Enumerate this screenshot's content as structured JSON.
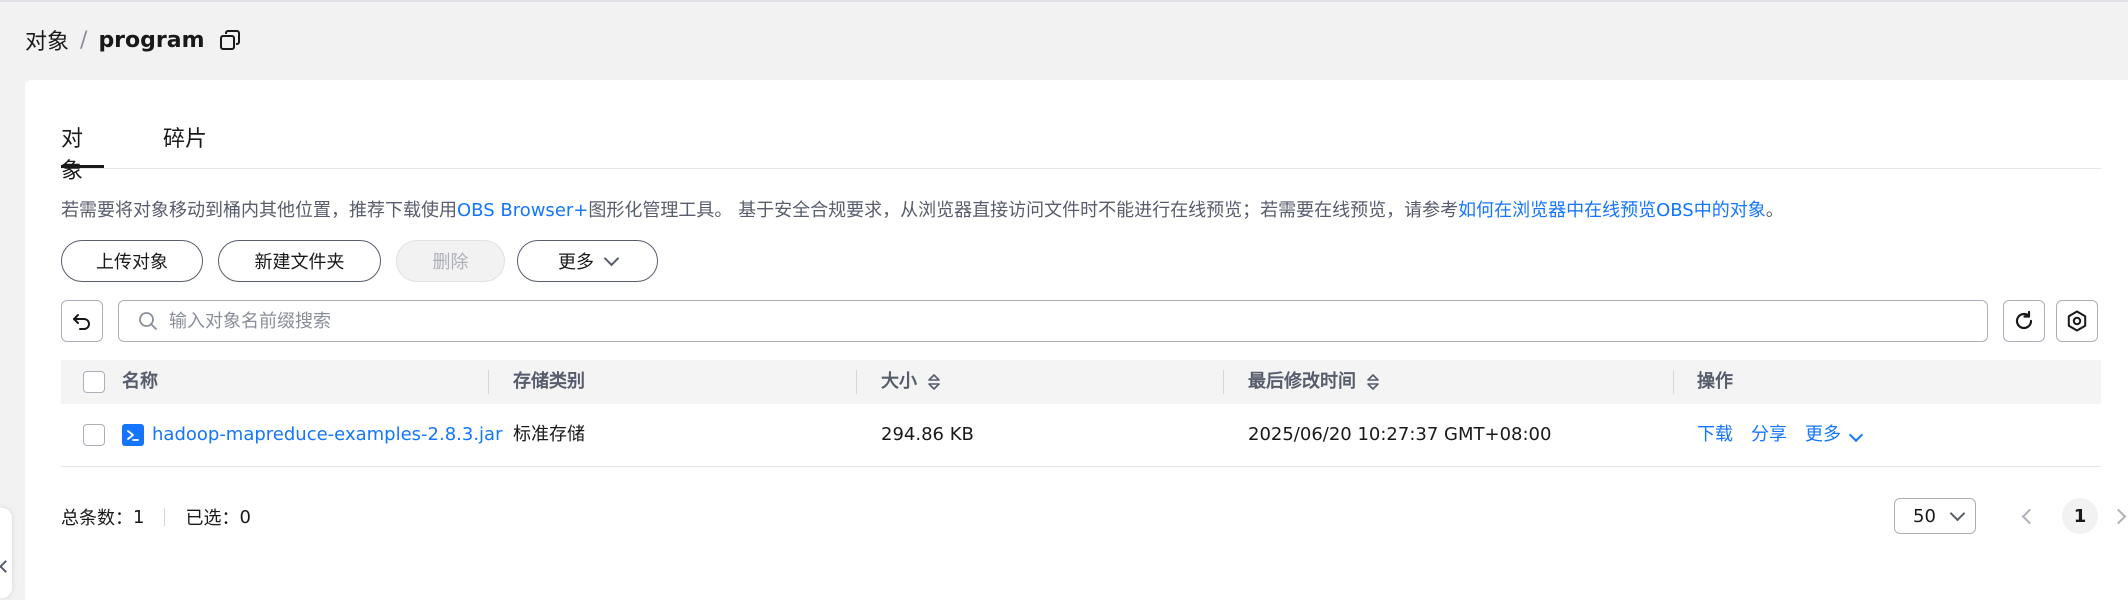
{
  "breadcrumb": {
    "root": "对象",
    "separator": "/",
    "current": "program"
  },
  "tabs": [
    {
      "label": "对象"
    },
    {
      "label": "碎片"
    }
  ],
  "notice": {
    "text1": "若需要将对象移动到桶内其他位置，推荐下载使用",
    "link1": "OBS Browser+",
    "text2": "图形化管理工具。 基于安全合规要求，从浏览器直接访问文件时不能进行在线预览；若需要在线预览，请参考",
    "link2": "如何在浏览器中在线预览OBS中的对象",
    "text3": "。"
  },
  "toolbar": {
    "upload": "上传对象",
    "new_folder": "新建文件夹",
    "delete": "删除",
    "more": "更多"
  },
  "search": {
    "placeholder": "输入对象名前缀搜索"
  },
  "table": {
    "headers": {
      "name": "名称",
      "storage": "存储类别",
      "size": "大小",
      "modified": "最后修改时间",
      "actions": "操作"
    },
    "rows": [
      {
        "name": "hadoop-mapreduce-examples-2.8.3.jar",
        "storage": "标准存储",
        "size": "294.86 KB",
        "modified": "2025/06/20 10:27:37 GMT+08:00",
        "actions": {
          "download": "下载",
          "share": "分享",
          "more": "更多"
        }
      }
    ]
  },
  "footer": {
    "total_label": "总条数：",
    "total": "1",
    "selected_label": "已选：",
    "selected": "0",
    "page_size": "50",
    "current_page": "1"
  },
  "colors": {
    "link": "#1476ff",
    "text": "#191919",
    "muted": "#575d6c",
    "border": "#adb0b8"
  },
  "icons": [
    "copy-icon",
    "undo-icon",
    "search-icon",
    "refresh-icon",
    "settings-icon",
    "sort-icon",
    "file-icon",
    "chevron-down-icon",
    "chevron-left-icon",
    "chevron-right-icon"
  ]
}
